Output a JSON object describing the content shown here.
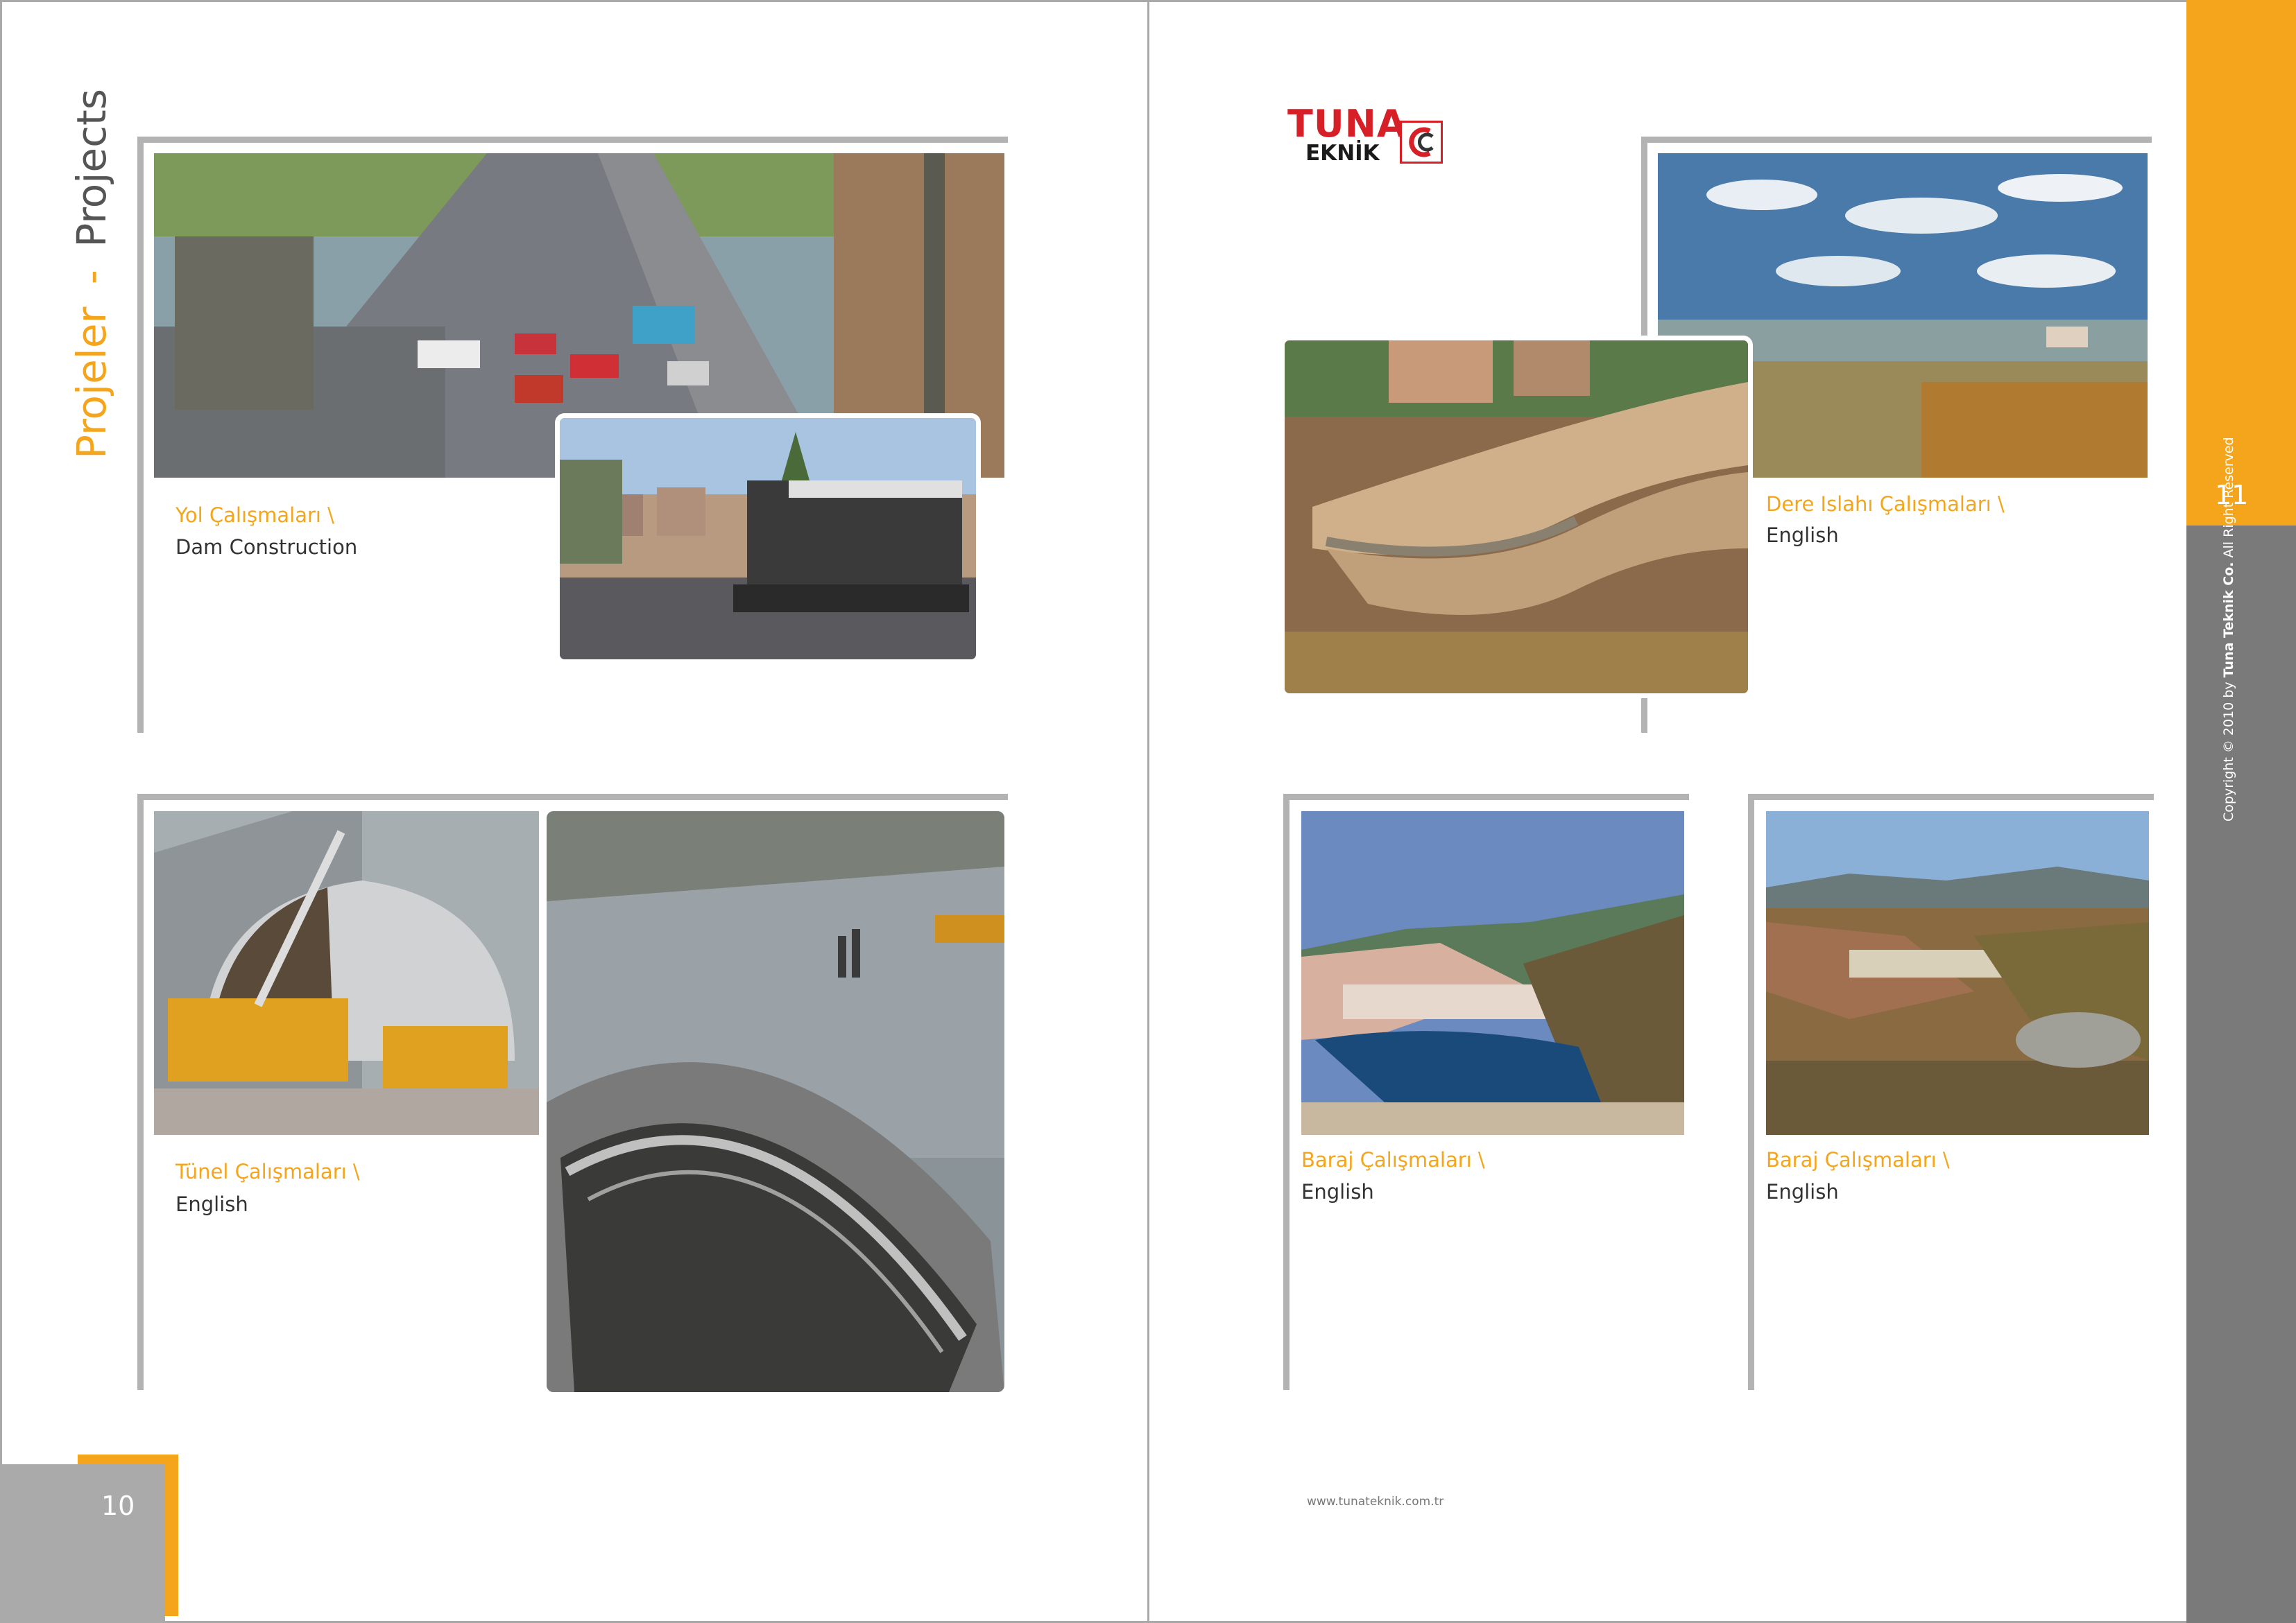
{
  "left_page": {
    "vertical_title": {
      "tr": "Projeler",
      "sep": "-",
      "en": "Projects"
    },
    "sections": [
      {
        "caption_tr": "Yol Çalışmaları \\",
        "caption_en": "Dam Construction"
      },
      {
        "caption_tr": "Tünel Çalışmaları \\",
        "caption_en": "English"
      }
    ],
    "page_number": "10"
  },
  "right_page": {
    "logo": {
      "line1": "TUNA",
      "line2": "EKNİK",
      "t_letter": "T"
    },
    "sections": [
      {
        "caption_tr": "Dere Islahı Çalışmaları \\",
        "caption_en": "English"
      },
      {
        "caption_tr": "Baraj Çalışmaları \\",
        "caption_en": "English"
      },
      {
        "caption_tr": "Baraj Çalışmaları \\",
        "caption_en": "English"
      }
    ],
    "website": "www.tunateknik.com.tr",
    "page_number": "11",
    "copyright": {
      "prefix": "Copyright © 2010 by ",
      "company": "Tuna Teknik Co.",
      "suffix": " All Right Reserved"
    }
  },
  "colors": {
    "accent": "#f4a51c",
    "sidebar_gray": "#7a7a7a",
    "page_gray": "#aaaaaa",
    "bracket": "#b3b3b3",
    "logo_red": "#d61f26"
  },
  "photos": [
    "road-traffic-photo",
    "asphalt-paver-photo",
    "tunnel-formwork-photo",
    "tunnel-arch-photo",
    "stream-channel-photo",
    "sky-landscape-photo",
    "dam-lake-photo",
    "dam-construction-photo"
  ]
}
